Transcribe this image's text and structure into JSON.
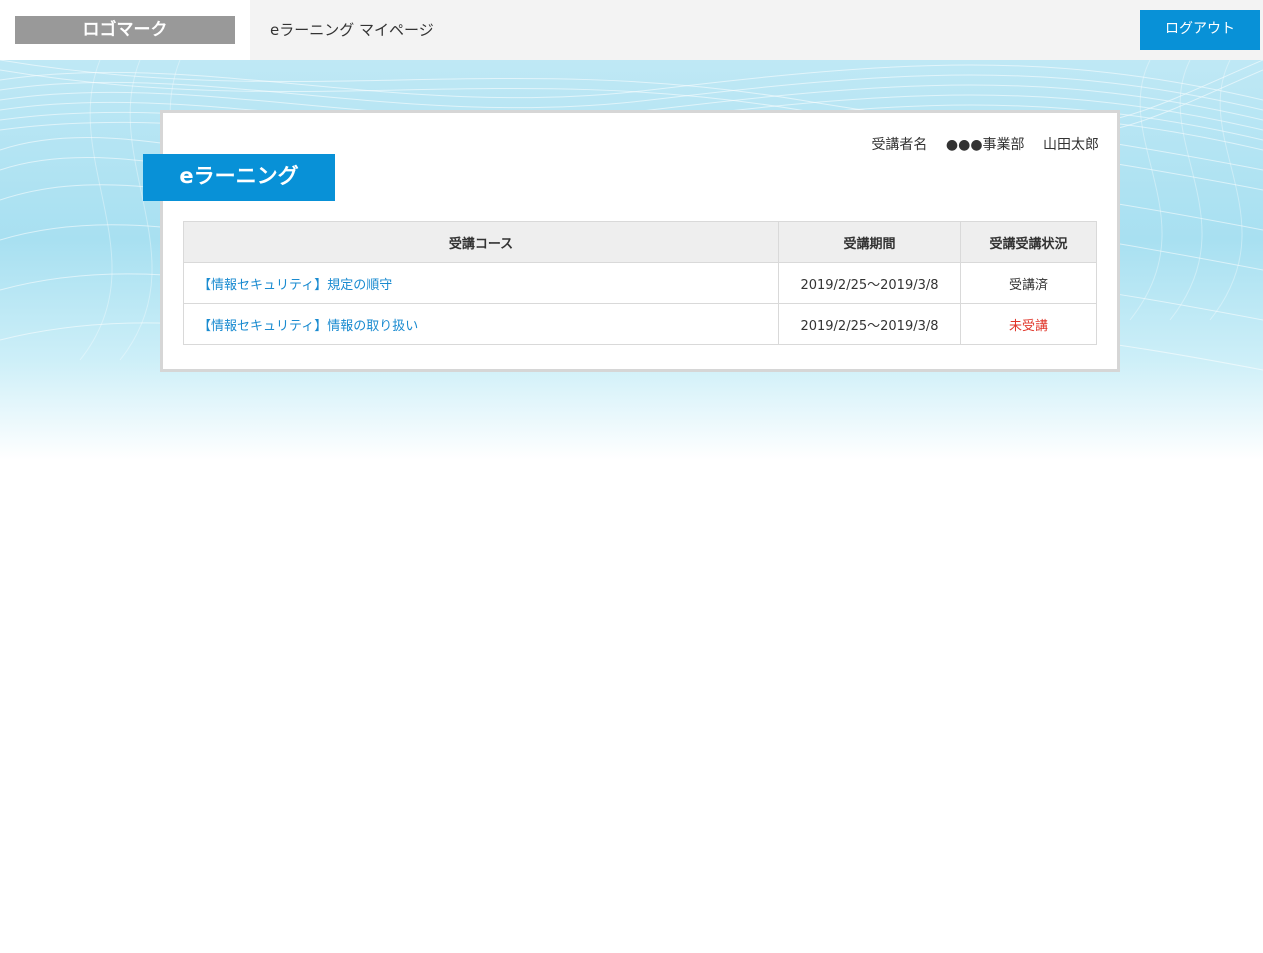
{
  "header": {
    "logo_text": "ロゴマーク",
    "site_title": "eラーニング マイページ",
    "logout_label": "ログアウト"
  },
  "user": {
    "label": "受講者名",
    "department": "●●●事業部",
    "name": "山田太郎"
  },
  "section": {
    "title": "eラーニング"
  },
  "table": {
    "headers": [
      "受講コース",
      "受講期間",
      "受講受講状況"
    ],
    "rows": [
      {
        "course": "【情報セキュリティ】規定の順守",
        "period": "2019/2/25〜2019/3/8",
        "status": "受講済"
      },
      {
        "course": "【情報セキュリティ】情報の取り扱い",
        "period": "2019/2/25〜2019/3/8",
        "status": "未受講"
      }
    ]
  },
  "colors": {
    "accent": "#0891d7",
    "link": "#1a8bd0",
    "status_pending": "#e0362a",
    "logo_bg": "#999999"
  }
}
